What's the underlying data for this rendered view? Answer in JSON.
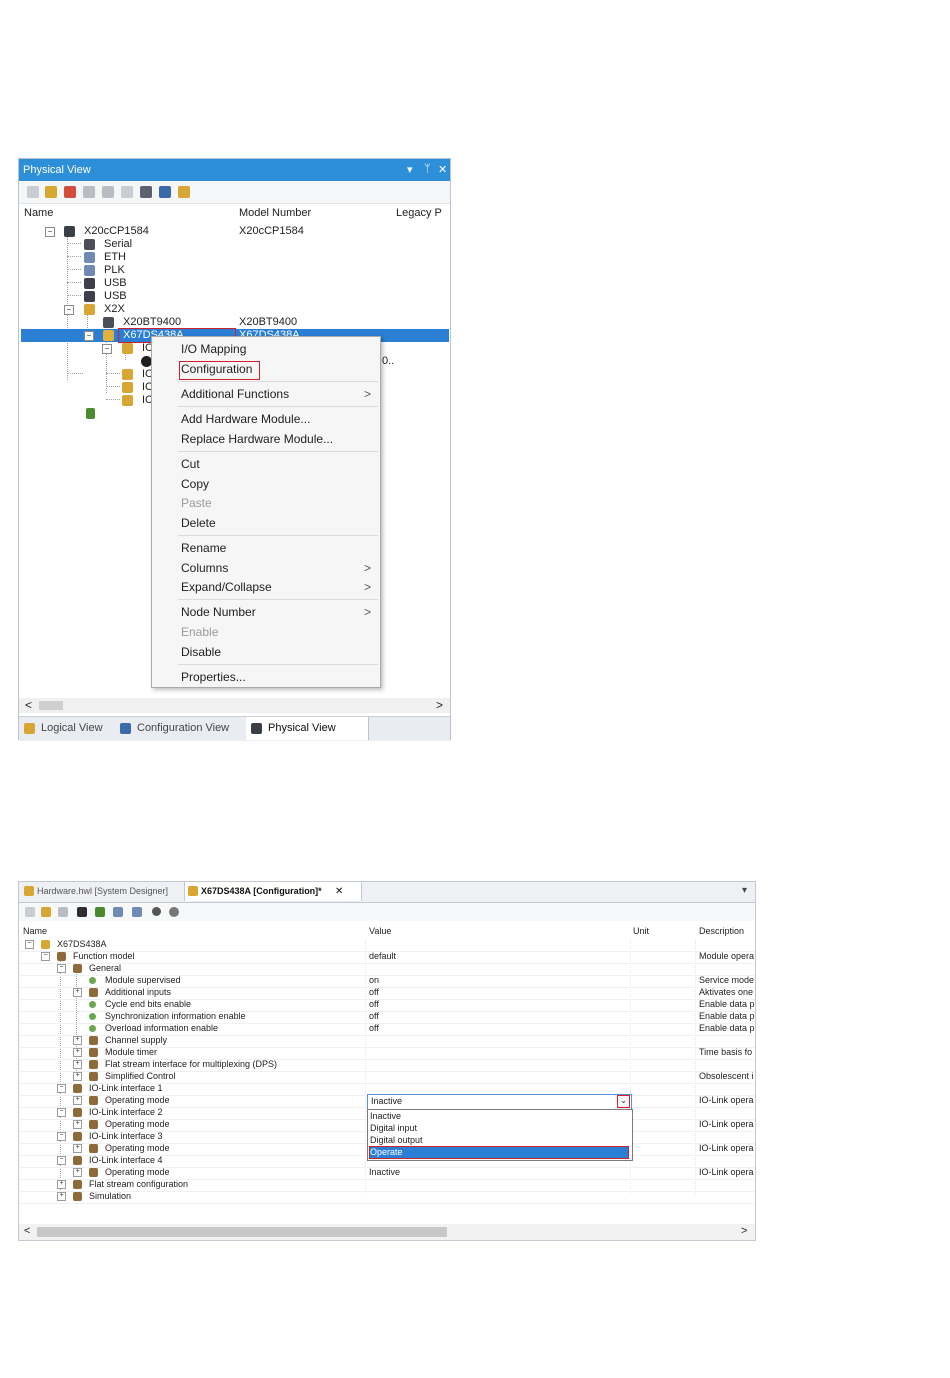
{
  "physical_view": {
    "title": "Physical View",
    "title_controls": [
      "▾",
      "ᛘ",
      "✕"
    ],
    "columns": [
      "Name",
      "Model Number",
      "Legacy P"
    ],
    "tree": [
      {
        "label": "X20cCP1584",
        "model": "X20cCP1584"
      },
      {
        "label": "Serial",
        "model": ""
      },
      {
        "label": "ETH",
        "model": ""
      },
      {
        "label": "PLK",
        "model": ""
      },
      {
        "label": "USB",
        "model": ""
      },
      {
        "label": "USB",
        "model": ""
      },
      {
        "label": "X2X",
        "model": ""
      },
      {
        "label": "X20BT9400",
        "model": "X20BT9400"
      },
      {
        "label": "X67DS438A",
        "model": "X67DS438A"
      },
      {
        "label": "IC",
        "model": ""
      },
      {
        "label": "",
        "model": ""
      },
      {
        "label": "IC",
        "model": ""
      },
      {
        "label": "IC",
        "model": ""
      },
      {
        "label": "IC",
        "model": ""
      },
      {
        "label": "",
        "model": ""
      }
    ],
    "partial_text": "0..",
    "context_menu": {
      "items": [
        {
          "label": "I/O Mapping",
          "disabled": false,
          "submenu": false
        },
        {
          "label": "Configuration",
          "disabled": false,
          "submenu": false
        },
        {
          "label": "Additional Functions",
          "disabled": false,
          "submenu": true
        },
        {
          "label": "Add Hardware Module...",
          "disabled": false,
          "submenu": false
        },
        {
          "label": "Replace Hardware Module...",
          "disabled": false,
          "submenu": false
        },
        {
          "label": "Cut",
          "disabled": false,
          "submenu": false
        },
        {
          "label": "Copy",
          "disabled": false,
          "submenu": false
        },
        {
          "label": "Paste",
          "disabled": true,
          "submenu": false
        },
        {
          "label": "Delete",
          "disabled": false,
          "submenu": false
        },
        {
          "label": "Rename",
          "disabled": false,
          "submenu": false
        },
        {
          "label": "Columns",
          "disabled": false,
          "submenu": true
        },
        {
          "label": "Expand/Collapse",
          "disabled": false,
          "submenu": true
        },
        {
          "label": "Node Number",
          "disabled": false,
          "submenu": true
        },
        {
          "label": "Enable",
          "disabled": true,
          "submenu": false
        },
        {
          "label": "Disable",
          "disabled": false,
          "submenu": false
        },
        {
          "label": "Properties...",
          "disabled": false,
          "submenu": false
        }
      ],
      "submenu_arrow": ">"
    },
    "scroll_left": "<",
    "scroll_right": ">",
    "tabs": [
      "Logical View",
      "Configuration View",
      "Physical View"
    ]
  },
  "configuration": {
    "tabs": [
      "Hardware.hwl [System Designer]",
      "X67DS438A [Configuration]*"
    ],
    "tab_close": "✕",
    "tab_menu": "▾",
    "columns": [
      "Name",
      "Value",
      "Unit",
      "Description"
    ],
    "rows": [
      {
        "name": "X67DS438A",
        "value": "",
        "desc": ""
      },
      {
        "name": "Function model",
        "value": "default",
        "desc": "Module opera"
      },
      {
        "name": "General",
        "value": "",
        "desc": ""
      },
      {
        "name": "Module supervised",
        "value": "on",
        "desc": "Service mode"
      },
      {
        "name": "Additional inputs",
        "value": "off",
        "desc": "Aktivates one"
      },
      {
        "name": "Cycle end bits enable",
        "value": "off",
        "desc": "Enable data p"
      },
      {
        "name": "Synchronization information enable",
        "value": "off",
        "desc": "Enable data p"
      },
      {
        "name": "Overload information enable",
        "value": "off",
        "desc": "Enable data p"
      },
      {
        "name": "Channel supply",
        "value": "",
        "desc": ""
      },
      {
        "name": "Module timer",
        "value": "",
        "desc": "Time basis fo"
      },
      {
        "name": "Flat stream interface for multiplexing (DPS)",
        "value": "",
        "desc": ""
      },
      {
        "name": "Simplified Control",
        "value": "",
        "desc": "Obsolescent i"
      },
      {
        "name": "IO-Link interface 1",
        "value": "",
        "desc": ""
      },
      {
        "name": "Operating mode",
        "value": "",
        "desc": "IO-Link opera"
      },
      {
        "name": "IO-Link interface 2",
        "value": "",
        "desc": ""
      },
      {
        "name": "Operating mode",
        "value": "",
        "desc": "IO-Link opera"
      },
      {
        "name": "IO-Link interface 3",
        "value": "",
        "desc": ""
      },
      {
        "name": "Operating mode",
        "value": "",
        "desc": "IO-Link opera"
      },
      {
        "name": "IO-Link interface 4",
        "value": "",
        "desc": ""
      },
      {
        "name": "Operating mode",
        "value": "Inactive",
        "desc": "IO-Link opera"
      },
      {
        "name": "Flat stream configuration",
        "value": "",
        "desc": ""
      },
      {
        "name": "Simulation",
        "value": "",
        "desc": ""
      }
    ],
    "combo": {
      "value": "Inactive",
      "button": "⌄"
    },
    "dropdown_options": [
      "Inactive",
      "Digital input",
      "Digital output",
      "Operate"
    ],
    "dropdown_selected": "Operate",
    "scroll_left": "<",
    "scroll_right": ">"
  },
  "colors": {
    "accent": "#2e8fd9",
    "selection": "#2a7fd4",
    "highlight_box": "#d0202a"
  }
}
